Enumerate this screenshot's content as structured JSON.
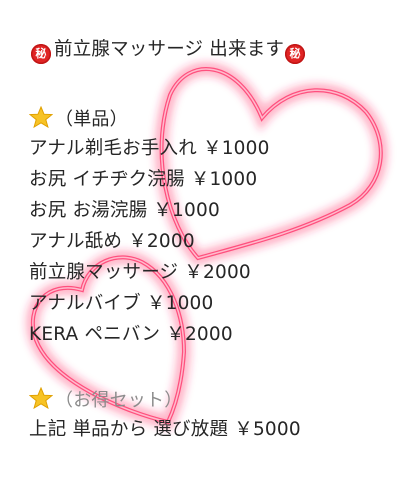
{
  "title": {
    "seal_left": "秘",
    "text": "前立腺マッサージ 出来ます",
    "seal_right": "秘"
  },
  "sections": [
    {
      "star_icon": "star-icon",
      "heading": "（単品）",
      "items": [
        "アナル剃毛お手入れ ￥1000",
        "お尻 イチヂク浣腸 ￥1000",
        "お尻 お湯浣腸 ￥1000",
        "アナル舐め ￥2000",
        "前立腺マッサージ ￥2000",
        "アナルバイブ ￥1000",
        "KERA ペニバン ￥2000"
      ]
    },
    {
      "star_icon": "star-icon",
      "heading": "（お得セット）",
      "items": [
        "上記 単品から 選び放題 ￥5000"
      ]
    }
  ],
  "colors": {
    "seal": "#e02424",
    "heart": "#ff2a62",
    "star": "#f7c325",
    "text": "#262626"
  }
}
